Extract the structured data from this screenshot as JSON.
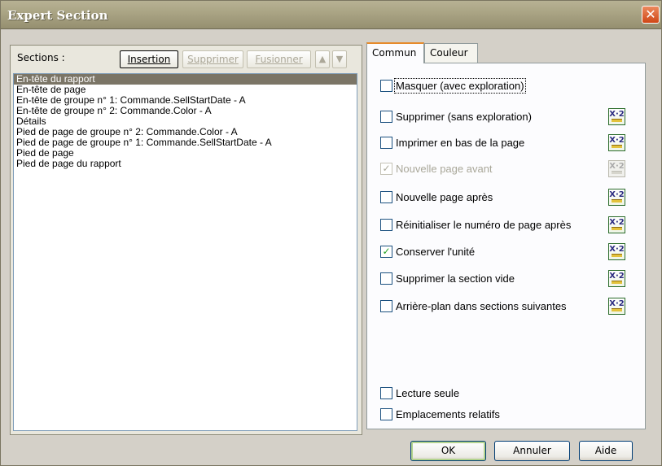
{
  "window": {
    "title": "Expert Section",
    "close_glyph": "✕"
  },
  "left": {
    "sections_label": "Sections :",
    "buttons": {
      "insertion": "Insertion",
      "supprimer": "Supprimer",
      "fusionner": "Fusionner",
      "up": "▲",
      "down": "▼"
    },
    "sections": [
      "En-tête du rapport",
      "En-tête de page",
      "En-tête de groupe n° 1: Commande.SellStartDate - A",
      "En-tête de groupe n° 2: Commande.Color - A",
      "Détails",
      "Pied de page de groupe n° 2: Commande.Color - A",
      "Pied de page de groupe n° 1: Commande.SellStartDate - A",
      "Pied de page",
      "Pied de page du rapport"
    ],
    "selected_index": 0
  },
  "tabs": {
    "commun": "Commun",
    "couleur": "Couleur"
  },
  "options": {
    "masquer": {
      "label": "Masquer (avec exploration)",
      "checked": false
    },
    "supprimer": {
      "label": "Supprimer (sans exploration)",
      "checked": false
    },
    "imprimer_bas": {
      "label": "Imprimer en bas de la page",
      "checked": false
    },
    "nouvelle_avant": {
      "label": "Nouvelle page avant",
      "checked": true,
      "disabled": true
    },
    "nouvelle_apres": {
      "label": "Nouvelle page après",
      "checked": false
    },
    "reinitialiser": {
      "label": "Réinitialiser le numéro de page après",
      "checked": false
    },
    "conserver": {
      "label": "Conserver l'unité",
      "checked": true
    },
    "supprimer_vide": {
      "label": "Supprimer la section vide",
      "checked": false
    },
    "arriere_plan": {
      "label": "Arrière-plan dans sections suivantes",
      "checked": false
    },
    "lecture_seule": {
      "label": "Lecture seule",
      "checked": false
    },
    "emplacements": {
      "label": "Emplacements relatifs",
      "checked": false
    }
  },
  "formula_icon_text": "X·2",
  "check_glyph": "✓",
  "footer": {
    "ok": "OK",
    "annuler": "Annuler",
    "aide": "Aide"
  },
  "colors": {
    "title_bar": "#a9a383",
    "selection": "#7b7566",
    "close_button": "#cf4716",
    "tab_accent": "#e68b2c"
  }
}
